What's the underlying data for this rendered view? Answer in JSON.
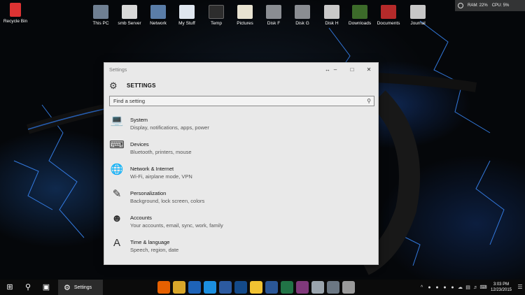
{
  "desktop": {
    "recycle_bin": "Recycle Bin",
    "icons": [
      {
        "label": "This PC",
        "icon": "computer-icon",
        "color": "#6f7f92"
      },
      {
        "label": "smb Server",
        "icon": "server-icon",
        "color": "#d8d8d8"
      },
      {
        "label": "Network",
        "icon": "network-icon",
        "color": "#5a7da8"
      },
      {
        "label": "My Stuff",
        "icon": "cloud-folder-icon",
        "color": "#dfe6ef"
      },
      {
        "label": "Temp",
        "icon": "folder-icon",
        "color": "#2d2d2d"
      },
      {
        "label": "Pictures",
        "icon": "pictures-icon",
        "color": "#e7e2d1"
      },
      {
        "label": "Disk F",
        "icon": "drive-icon",
        "color": "#8a8d92"
      },
      {
        "label": "Disk G",
        "icon": "drive-icon",
        "color": "#8a8d92"
      },
      {
        "label": "Disk H",
        "icon": "network-drive-icon",
        "color": "#c9c9c9"
      },
      {
        "label": "Downloads",
        "icon": "downloads-icon",
        "color": "#3c6b2a"
      },
      {
        "label": "Documents",
        "icon": "documents-icon",
        "color": "#b52a2a"
      },
      {
        "label": "Journal",
        "icon": "journal-icon",
        "color": "#c7c7c7"
      }
    ],
    "tray_widget": {
      "ram": "RAM: 22%",
      "cpu": "CPU: 5%"
    }
  },
  "window": {
    "title": "Settings",
    "header": "SETTINGS",
    "search_placeholder": "Find a setting",
    "items": [
      {
        "name": "System",
        "desc": "Display, notifications, apps, power",
        "icon": "laptop-icon"
      },
      {
        "name": "Devices",
        "desc": "Bluetooth, printers, mouse",
        "icon": "devices-icon"
      },
      {
        "name": "Network & Internet",
        "desc": "Wi-Fi, airplane mode, VPN",
        "icon": "globe-icon"
      },
      {
        "name": "Personalization",
        "desc": "Background, lock screen, colors",
        "icon": "paint-icon"
      },
      {
        "name": "Accounts",
        "desc": "Your accounts, email, sync, work, family",
        "icon": "person-icon"
      },
      {
        "name": "Time & language",
        "desc": "Speech, region, date",
        "icon": "time-language-icon"
      }
    ]
  },
  "taskbar": {
    "active_app": "Settings",
    "pinned": [
      {
        "icon": "firefox-icon",
        "color": "#e66000"
      },
      {
        "icon": "chrome-icon",
        "color": "#d9a72a"
      },
      {
        "icon": "ie-icon",
        "color": "#1e63b8"
      },
      {
        "icon": "teamviewer-icon",
        "color": "#1c8fe0"
      },
      {
        "icon": "app-icon",
        "color": "#2c5aa0"
      },
      {
        "icon": "app-icon-2",
        "color": "#144a8a"
      },
      {
        "icon": "explorer-icon",
        "color": "#f1c232"
      },
      {
        "icon": "word-icon",
        "color": "#2b5797"
      },
      {
        "icon": "excel-icon",
        "color": "#217346"
      },
      {
        "icon": "onenote-icon",
        "color": "#80397b"
      },
      {
        "icon": "snipping-icon",
        "color": "#9aa4ad"
      },
      {
        "icon": "tools-icon",
        "color": "#6b7783"
      },
      {
        "icon": "gear-icon",
        "color": "#9a9a9a"
      }
    ],
    "time": "3:03 PM",
    "date": "12/23/2015"
  }
}
